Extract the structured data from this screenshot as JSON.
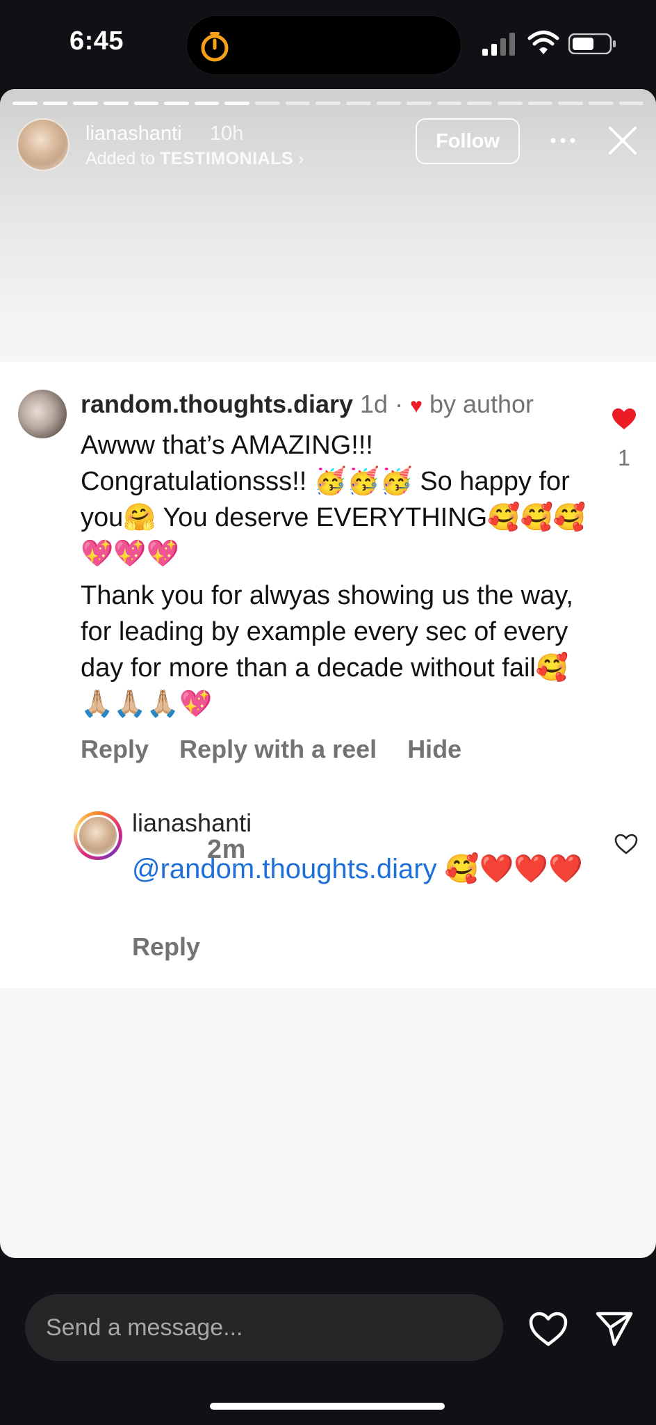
{
  "status_bar": {
    "time": "6:45"
  },
  "story": {
    "progress_total": 21,
    "progress_done": 8,
    "username": "lianashanti",
    "time": "10h",
    "subtitle_prefix": "Added to",
    "subtitle_highlight": "TESTIMONIALS",
    "subtitle_chevron": "›",
    "follow_label": "Follow"
  },
  "comment": {
    "username": "random.thoughts.diary",
    "time": "1d",
    "separator": "·",
    "liked_by": "by author",
    "paragraphs": [
      "Awww that’s AMAZING!!! Congratulationsss!! 🥳🥳🥳 So happy for you🤗 You deserve EVERYTHING🥰🥰🥰💖💖💖",
      "Thank you for alwyas showing us the way, for leading by example every sec of every day for more than a decade without fail🥰🙏🏼🙏🏼🙏🏼💖"
    ],
    "actions": [
      "Reply",
      "Reply with a reel",
      "Hide"
    ],
    "like_count": "1"
  },
  "reply": {
    "username": "lianashanti",
    "time": "2m",
    "mention": "@random.thoughts.diary",
    "text": " 🥰❤️❤️❤️",
    "action": "Reply"
  },
  "bottom_bar": {
    "placeholder": "Send a message..."
  },
  "colors": {
    "like_red": "#ed1c24",
    "mention_blue": "#1e6fd9",
    "meta_gray": "#737373"
  }
}
